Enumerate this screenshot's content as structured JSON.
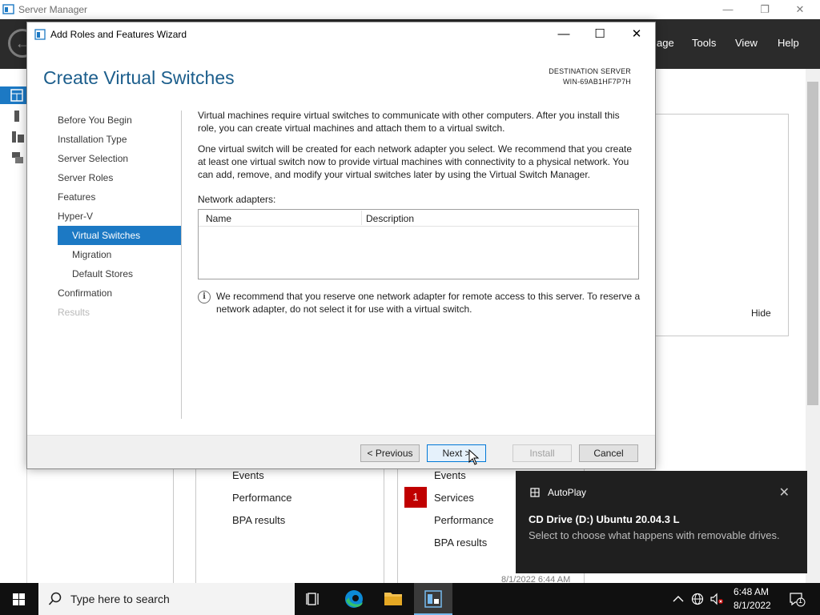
{
  "server_manager": {
    "title": "Server Manager",
    "menu": {
      "manage_partial": "age",
      "tools": "Tools",
      "view": "View",
      "help": "Help"
    },
    "hide_label": "Hide",
    "tile_left": {
      "items": [
        "Events",
        "Performance",
        "BPA results"
      ]
    },
    "tile_right": {
      "badge": "1",
      "items": [
        "Events",
        "Services",
        "Performance",
        "BPA results"
      ]
    },
    "timestamp_partial": "8/1/2022 6:44 AM"
  },
  "wizard": {
    "title": "Add Roles and Features Wizard",
    "page_title": "Create Virtual Switches",
    "destination_label": "DESTINATION SERVER",
    "destination_value": "WIN-69AB1HF7P7H",
    "nav": [
      {
        "label": "Before You Begin",
        "state": "normal"
      },
      {
        "label": "Installation Type",
        "state": "normal"
      },
      {
        "label": "Server Selection",
        "state": "normal"
      },
      {
        "label": "Server Roles",
        "state": "normal"
      },
      {
        "label": "Features",
        "state": "normal"
      },
      {
        "label": "Hyper-V",
        "state": "normal"
      },
      {
        "label": "Virtual Switches",
        "state": "active"
      },
      {
        "label": "Migration",
        "state": "normal"
      },
      {
        "label": "Default Stores",
        "state": "normal"
      },
      {
        "label": "Confirmation",
        "state": "normal"
      },
      {
        "label": "Results",
        "state": "disabled"
      }
    ],
    "para1": "Virtual machines require virtual switches to communicate with other computers. After you install this role, you can create virtual machines and attach them to a virtual switch.",
    "para2": "One virtual switch will be created for each network adapter you select. We recommend that you create at least one virtual switch now to provide virtual machines with connectivity to a physical network. You can add, remove, and modify your virtual switches later by using the Virtual Switch Manager.",
    "adapters_label": "Network adapters:",
    "table_headers": {
      "name": "Name",
      "description": "Description"
    },
    "info_text": "We recommend that you reserve one network adapter for remote access to this server. To reserve a network adapter, do not select it for use with a virtual switch.",
    "buttons": {
      "previous": "< Previous",
      "next": "Next >",
      "install": "Install",
      "cancel": "Cancel"
    }
  },
  "toast": {
    "app": "AutoPlay",
    "title": "CD Drive (D:) Ubuntu 20.04.3 L",
    "body": "Select to choose what happens with removable drives."
  },
  "taskbar": {
    "search_placeholder": "Type here to search",
    "time": "6:48 AM",
    "date": "8/1/2022",
    "notification_count": "1"
  },
  "colors": {
    "accent": "#1c79c4",
    "title_blue": "#1c5e8c",
    "header_dark": "#2b2b2b",
    "badge_red": "#c00000",
    "toast_bg": "#1f1f1f",
    "taskbar_bg": "#101010"
  }
}
